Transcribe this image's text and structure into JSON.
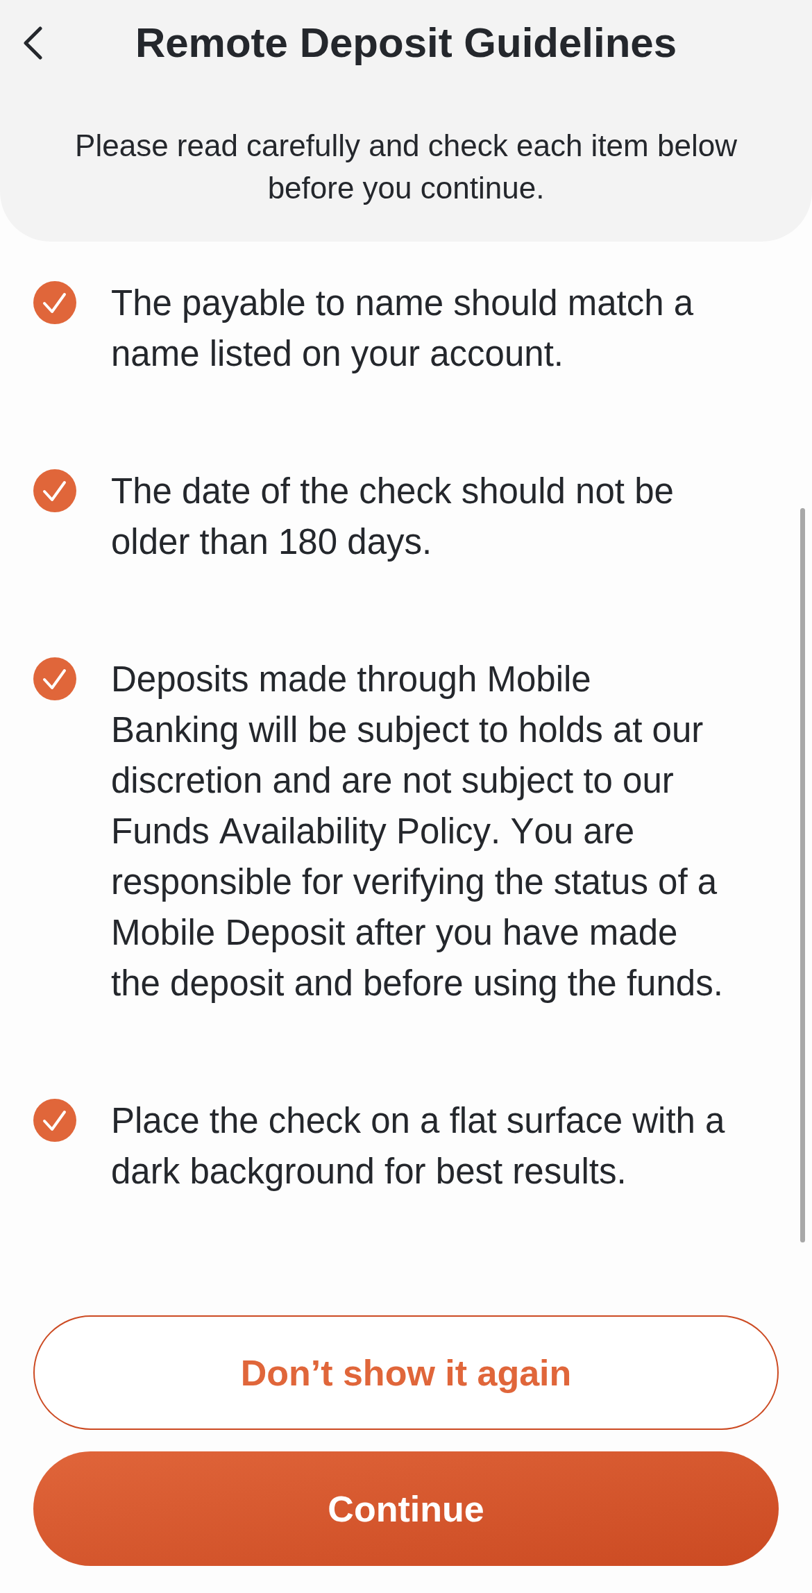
{
  "header": {
    "title": "Remote Deposit Guidelines",
    "subtitle": "Please read carefully and check each item below before you continue."
  },
  "items": [
    {
      "text": "The payable to name should match a name listed on your account.",
      "checked": true
    },
    {
      "text": "The date of the check should not be older than 180 days.",
      "checked": true
    },
    {
      "text": "Deposits made through Mobile Banking will be subject to holds at our discretion and are not subject to our Funds Availability Policy. You are responsible for verifying the status of a Mobile Deposit after you have made the deposit and before using the funds.",
      "checked": true
    },
    {
      "text": "Place the check on a flat surface with a dark background for best results.",
      "checked": true
    }
  ],
  "buttons": [
    {
      "label": "Don’t show it again",
      "kind": "outline"
    },
    {
      "label": "Continue",
      "kind": "primary"
    }
  ]
}
